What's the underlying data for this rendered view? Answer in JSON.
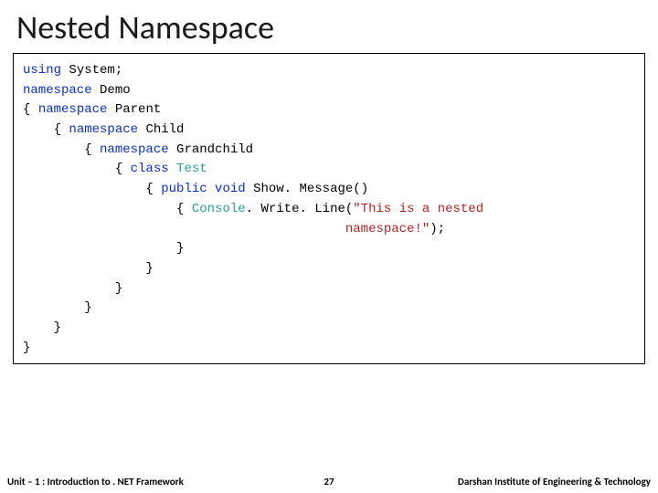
{
  "title": "Nested Namespace",
  "code": {
    "l1": {
      "kw": "using",
      "rest": " System;"
    },
    "l2": {
      "kw": "namespace",
      "rest": " Demo"
    },
    "l3": "{ ",
    "l3b": {
      "kw": "namespace",
      "rest": " Parent"
    },
    "l4a": "    { ",
    "l4b": {
      "kw": "namespace",
      "rest": " Child"
    },
    "l5a": "        { ",
    "l5b": {
      "kw": "namespace",
      "rest": " Grandchild"
    },
    "l6a": "            { ",
    "l6b": {
      "kw": "class",
      "type": " Test"
    },
    "l7a": "                { ",
    "l7b": {
      "kw1": "public",
      "kw2": " void",
      "rest": " Show. Message()"
    },
    "l8a": "                    { ",
    "l8b": {
      "type": "Console",
      "mid": ". Write. Line(",
      "str": "\"This is a nested"
    },
    "l9a": "                                          ",
    "l9b": {
      "str": "namespace!\"",
      "rest": ");"
    },
    "l10": "                    }",
    "l11": "                }",
    "l12": "            }",
    "l13": "        }",
    "l14": "    }",
    "l15": "}"
  },
  "footer": {
    "left": "Unit – 1 : Introduction to . NET Framework",
    "page": "27",
    "right": "Darshan Institute of Engineering & Technology"
  }
}
